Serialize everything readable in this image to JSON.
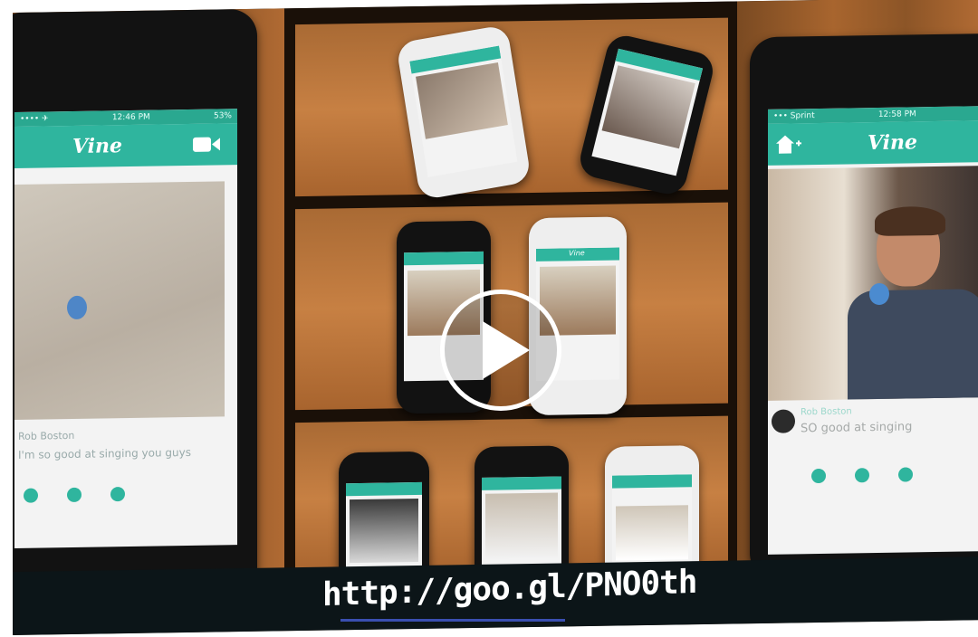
{
  "video": {
    "url_text": "http://goo.gl/PNO0th",
    "play_button_label": "Play"
  },
  "left_phone": {
    "status_time": "12:46 PM",
    "status_carrier": "•••• ✈",
    "status_battery": "53%",
    "app_name": "Vine",
    "user_name": "Rob Boston",
    "caption": "I'm so good at singing you guys"
  },
  "right_phone": {
    "status_time": "12:58 PM",
    "status_carrier": "••• Sprint",
    "app_name": "Vine",
    "user_name": "Rob Boston",
    "caption": "SO good at singing"
  },
  "small_phone_bar_label": "Vine",
  "icons": {
    "play": "play-triangle-icon",
    "camera": "video-camera-icon",
    "home": "home-icon"
  },
  "colors": {
    "vine_teal": "#2fb59e",
    "url_bar": "#0c1518",
    "link_underline": "#3a4fb0"
  }
}
